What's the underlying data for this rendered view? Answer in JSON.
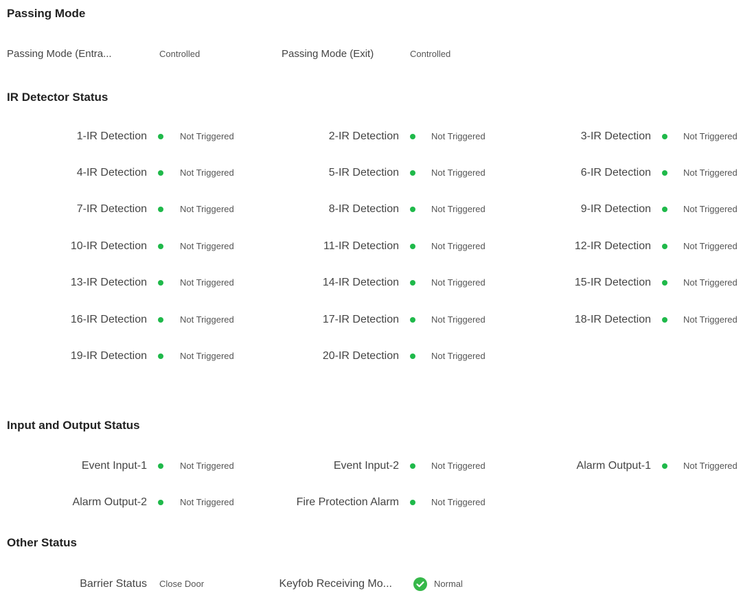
{
  "passing_mode": {
    "title": "Passing Mode",
    "entrance_label": "Passing Mode (Entra...",
    "entrance_value": "Controlled",
    "exit_label": "Passing Mode (Exit)",
    "exit_value": "Controlled"
  },
  "ir": {
    "title": "IR Detector Status",
    "items": [
      {
        "label": "1-IR Detection",
        "status": "Not Triggered"
      },
      {
        "label": "2-IR Detection",
        "status": "Not Triggered"
      },
      {
        "label": "3-IR Detection",
        "status": "Not Triggered"
      },
      {
        "label": "4-IR Detection",
        "status": "Not Triggered"
      },
      {
        "label": "5-IR Detection",
        "status": "Not Triggered"
      },
      {
        "label": "6-IR Detection",
        "status": "Not Triggered"
      },
      {
        "label": "7-IR Detection",
        "status": "Not Triggered"
      },
      {
        "label": "8-IR Detection",
        "status": "Not Triggered"
      },
      {
        "label": "9-IR Detection",
        "status": "Not Triggered"
      },
      {
        "label": "10-IR Detection",
        "status": "Not Triggered"
      },
      {
        "label": "11-IR Detection",
        "status": "Not Triggered"
      },
      {
        "label": "12-IR Detection",
        "status": "Not Triggered"
      },
      {
        "label": "13-IR Detection",
        "status": "Not Triggered"
      },
      {
        "label": "14-IR Detection",
        "status": "Not Triggered"
      },
      {
        "label": "15-IR Detection",
        "status": "Not Triggered"
      },
      {
        "label": "16-IR Detection",
        "status": "Not Triggered"
      },
      {
        "label": "17-IR Detection",
        "status": "Not Triggered"
      },
      {
        "label": "18-IR Detection",
        "status": "Not Triggered"
      },
      {
        "label": "19-IR Detection",
        "status": "Not Triggered"
      },
      {
        "label": "20-IR Detection",
        "status": "Not Triggered"
      }
    ]
  },
  "io": {
    "title": "Input and Output Status",
    "items": [
      {
        "label": "Event Input-1",
        "status": "Not Triggered"
      },
      {
        "label": "Event Input-2",
        "status": "Not Triggered"
      },
      {
        "label": "Alarm Output-1",
        "status": "Not Triggered"
      },
      {
        "label": "Alarm Output-2",
        "status": "Not Triggered"
      },
      {
        "label": "Fire Protection Alarm",
        "status": "Not Triggered"
      }
    ]
  },
  "other": {
    "title": "Other Status",
    "barrier_label": "Barrier Status",
    "barrier_value": "Close Door",
    "keyfob_label": "Keyfob Receiving Mo...",
    "keyfob_value": "Normal"
  },
  "colors": {
    "status_ok": "#1fb94a"
  },
  "icons": {
    "status_dot": "green-dot-icon",
    "normal_check": "check-circle-icon"
  }
}
